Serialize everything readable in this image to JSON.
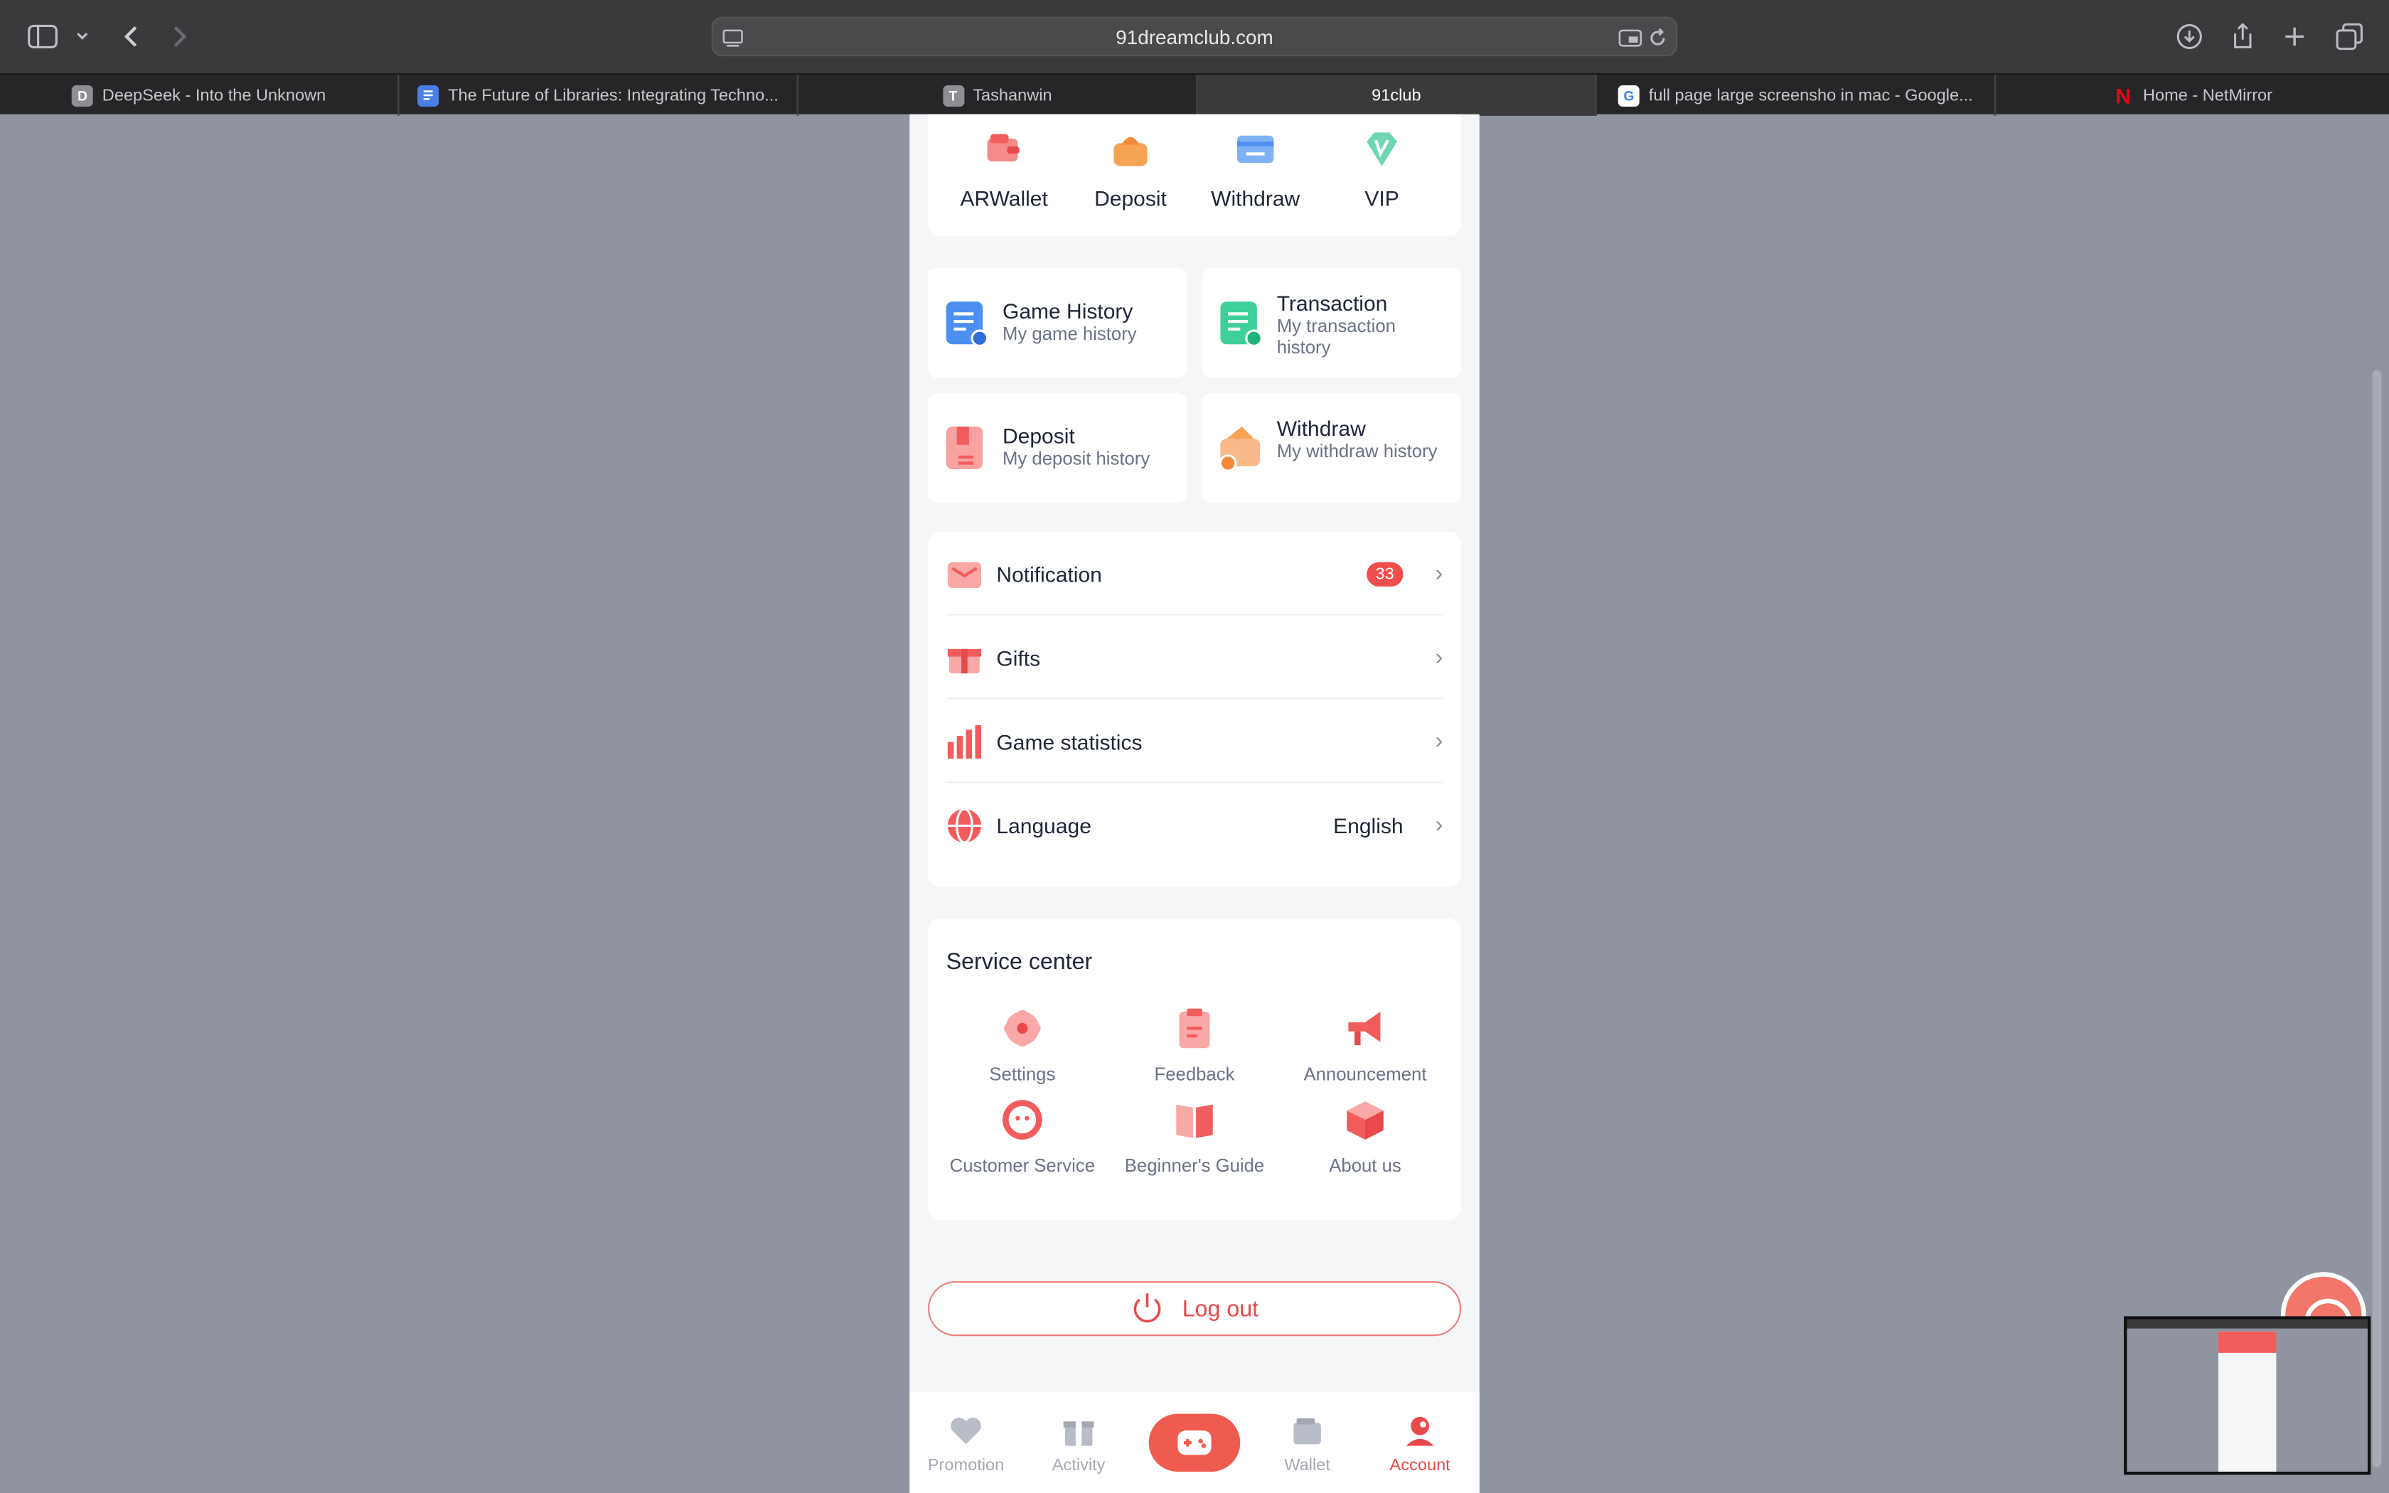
{
  "browser": {
    "url": "91dreamclub.com",
    "tabs": [
      {
        "label": "DeepSeek - Into the Unknown",
        "fav": "D"
      },
      {
        "label": "The Future of Libraries: Integrating Techno...",
        "fav": ""
      },
      {
        "label": "Tashanwin",
        "fav": "T"
      },
      {
        "label": "91club",
        "fav": ""
      },
      {
        "label": "full page large screensho in mac - Google...",
        "fav": "G"
      },
      {
        "label": "Home - NetMirror",
        "fav": "N"
      }
    ]
  },
  "quick_actions": [
    "ARWallet",
    "Deposit",
    "Withdraw",
    "VIP"
  ],
  "history_cards": [
    {
      "title": "Game History",
      "subtitle": "My game history"
    },
    {
      "title": "Transaction",
      "subtitle": "My transaction history"
    },
    {
      "title": "Deposit",
      "subtitle": "My deposit history"
    },
    {
      "title": "Withdraw",
      "subtitle": "My withdraw history"
    }
  ],
  "menu": {
    "notification": {
      "label": "Notification",
      "badge": "33"
    },
    "gifts": {
      "label": "Gifts"
    },
    "game_statistics": {
      "label": "Game statistics"
    },
    "language": {
      "label": "Language",
      "value": "English"
    }
  },
  "service_center": {
    "title": "Service center",
    "items": [
      "Settings",
      "Feedback",
      "Announcement",
      "Customer Service",
      "Beginner's Guide",
      "About us"
    ]
  },
  "logout_label": "Log out",
  "bottom_nav": [
    "Promotion",
    "Activity",
    "Wallet",
    "Account"
  ],
  "colors": {
    "accent": "#e8494a",
    "page_bg": "#8f94a0"
  }
}
